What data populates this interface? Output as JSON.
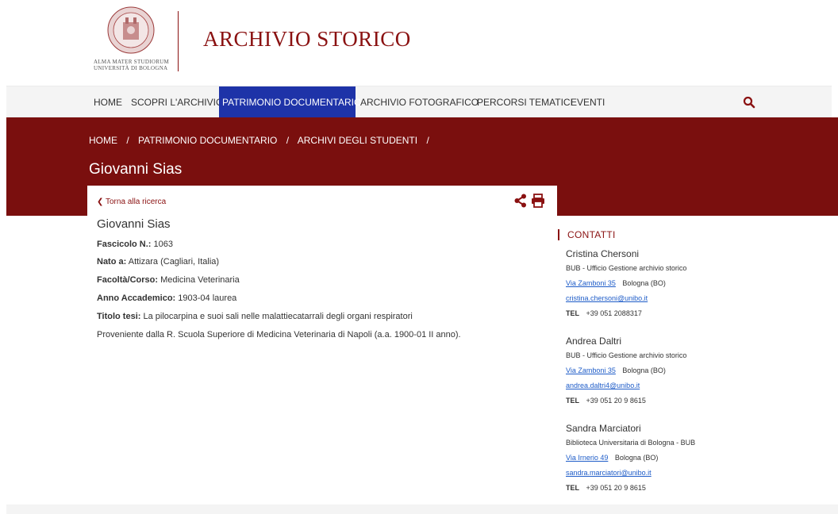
{
  "header": {
    "seal_text_line1": "ALMA MATER STUDIORUM",
    "seal_text_line2": "UNIVERSITÀ DI BOLOGNA",
    "title": "ARCHIVIO STORICO"
  },
  "nav": {
    "items": [
      "HOME",
      "SCOPRI L'ARCHIVIO",
      "PATRIMONIO DOCUMENTARIO",
      "ARCHIVIO FOTOGRAFICO",
      "PERCORSI TEMATICI",
      "EVENTI"
    ],
    "active_index": 2,
    "search_icon": "search-icon"
  },
  "breadcrumb": [
    "HOME",
    "/",
    "PATRIMONIO DOCUMENTARIO",
    "/",
    "ARCHIVI DEGLI STUDENTI",
    "/"
  ],
  "page_title": "Giovanni Sias",
  "record": {
    "back_label": "Torna alla ricerca",
    "title": "Giovanni Sias",
    "fascicolo_label": "Fascicolo N.:",
    "fascicolo_value": "1063",
    "nato_label": "Nato a:",
    "nato_value": "Attizara (Cagliari, Italia)",
    "facolta_label": "Facoltà/Corso:",
    "facolta_value": "Medicina Veterinaria",
    "anno_label": "Anno Accademico:",
    "anno_value": "1903-04 laurea",
    "titolo_label": "Titolo tesi:",
    "titolo_value": "La pilocarpina e suoi sali nelle malattiecatarrali degli organi respiratori",
    "provenienza": "Proveniente dalla R. Scuola Superiore di Medicina Veterinaria di Napoli (a.a. 1900-01 II anno)."
  },
  "sidebar": {
    "title": "CONTATTI",
    "contacts": [
      {
        "name": "Cristina Chersoni",
        "office": "BUB - Ufficio Gestione archivio storico",
        "address_link": "Via Zamboni 35",
        "city": "Bologna (BO)",
        "email": "cristina.chersoni@unibo.it",
        "tel_label": "TEL",
        "tel": "+39 051 2088317"
      },
      {
        "name": "Andrea Daltri",
        "office": "BUB - Ufficio Gestione archivio storico",
        "address_link": "Via Zamboni 35",
        "city": "Bologna (BO)",
        "email": "andrea.daltri4@unibo.it",
        "tel_label": "TEL",
        "tel": "+39 051 20 9 8615"
      },
      {
        "name": "Sandra Marciatori",
        "office": "Biblioteca Universitaria di Bologna - BUB",
        "address_link": "Via Irnerio 49",
        "city": "Bologna (BO)",
        "email": "sandra.marciatori@unibo.it",
        "tel_label": "TEL",
        "tel": "+39 051 20 9 8615"
      }
    ]
  },
  "colors": {
    "brand_red": "#7a0f0e",
    "nav_active": "#1e33a8",
    "link_blue": "#1e5cc8"
  }
}
